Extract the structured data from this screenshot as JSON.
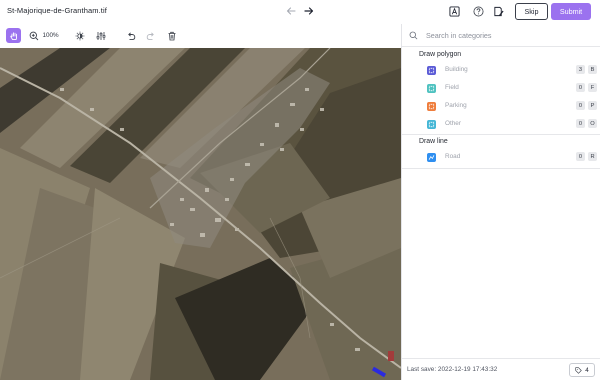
{
  "header": {
    "filename": "St-Majorique-de-Grantham.tif",
    "skip_label": "Skip",
    "submit_label": "Submit"
  },
  "toolbar": {
    "zoom_level": "100%"
  },
  "panel": {
    "search_placeholder": "Search in categories",
    "sections": [
      {
        "title": "Draw polygon",
        "items": [
          {
            "label": "Building",
            "hotkey_count": "3",
            "hotkey": "B",
            "color": "#5b5bd6"
          },
          {
            "label": "Field",
            "hotkey_count": "0",
            "hotkey": "F",
            "color": "#4fc2c0"
          },
          {
            "label": "Parking",
            "hotkey_count": "0",
            "hotkey": "P",
            "color": "#ef7d3c"
          },
          {
            "label": "Other",
            "hotkey_count": "0",
            "hotkey": "O",
            "color": "#46b7d6"
          }
        ]
      },
      {
        "title": "Draw line",
        "items": [
          {
            "label": "Road",
            "hotkey_count": "0",
            "hotkey": "R",
            "color": "#2f8ff0"
          }
        ]
      }
    ],
    "footer": {
      "last_save": "Last save: 2022-12-19 17:43:32",
      "issues_count": "4"
    }
  },
  "colors": {
    "accent": "#9b72ef"
  }
}
